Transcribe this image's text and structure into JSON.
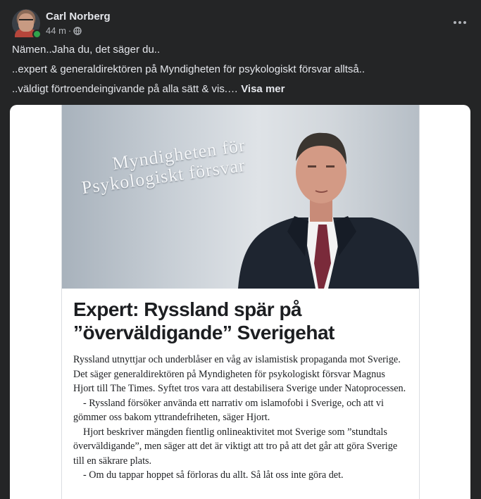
{
  "post": {
    "author": "Carl Norberg",
    "time": "44 m",
    "separator": "·",
    "privacy_icon": "globe-icon",
    "more_icon": "more-options-icon",
    "text_lines": [
      "Nämen..Jaha du, det säger du..",
      "..expert & generaldirektören på Myndigheten för psykologiskt försvar alltså..",
      "..väldigt förtroendeingivande på alla sätt & vis.…"
    ],
    "see_more": "Visa mer",
    "online_color": "#31a24c"
  },
  "article": {
    "photo_sign_line1": "Myndigheten för",
    "photo_sign_line2": "Psykologiskt försvar",
    "headline_line1": "Expert: Ryssland spär på",
    "headline_line2": "”överväldigande” Sverigehat",
    "paragraphs": [
      "Ryssland utnyttjar och underblåser en våg av islamistisk propaganda mot Sverige. Det säger generaldirektören på Myndigheten för psykologiskt försvar Magnus Hjort till The Times. Syftet tros vara att destabilisera Sverige under Natoprocessen.",
      "- Ryssland försöker använda ett narrativ om islamofobi i Sverige, och att vi gömmer oss bakom yttrandefriheten, säger Hjort.",
      "Hjort beskriver mängden fientlig onlineaktivitet mot Sverige som ”stundtals överväldigande”, men säger att det är viktigt att tro på att det går att göra Sverige till en säkrare plats.",
      "- Om du tappar hoppet så förloras du allt. Så låt oss inte göra det."
    ]
  }
}
